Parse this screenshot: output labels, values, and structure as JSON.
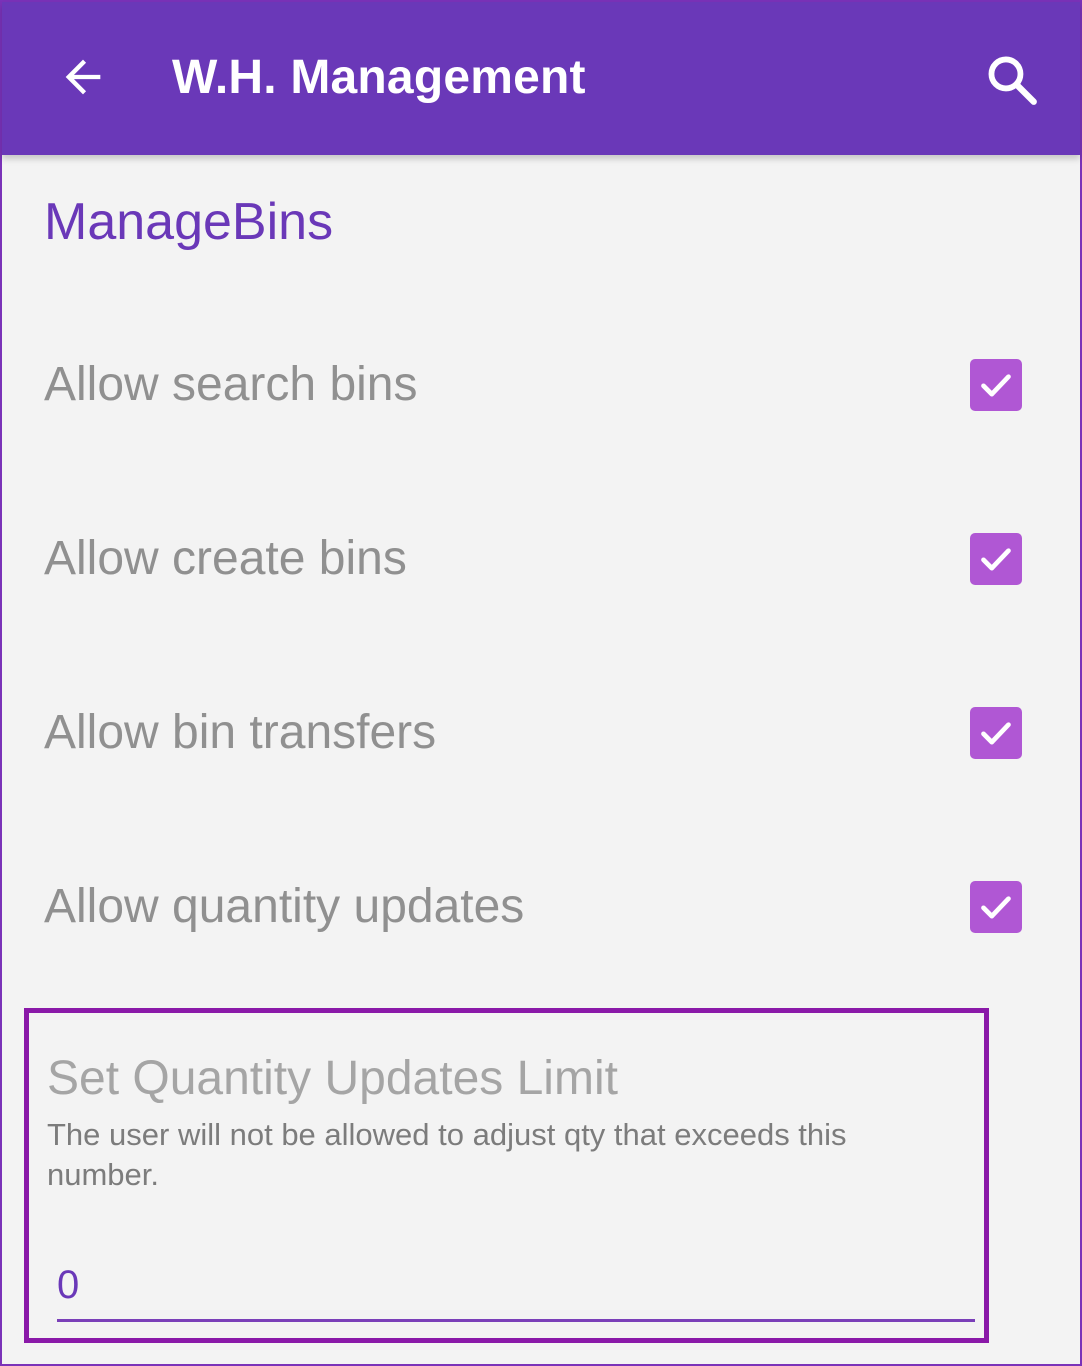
{
  "appbar": {
    "title": "W.H. Management",
    "back_icon": "arrow-left-icon",
    "search_icon": "search-icon",
    "color": "#6a38b8"
  },
  "section": {
    "title": "ManageBins"
  },
  "preferences": [
    {
      "label": "Allow search bins",
      "checked": true
    },
    {
      "label": "Allow create bins",
      "checked": true
    },
    {
      "label": "Allow bin transfers",
      "checked": true
    },
    {
      "label": "Allow quantity updates",
      "checked": true
    }
  ],
  "limit": {
    "title": "Set Quantity Updates Limit",
    "summary": "The user will not be allowed to adjust qty that exceeds this number.",
    "value": "0"
  },
  "colors": {
    "accent": "#6a38b8",
    "checkbox": "#b057d4",
    "highlight_border": "#8a19a8"
  }
}
